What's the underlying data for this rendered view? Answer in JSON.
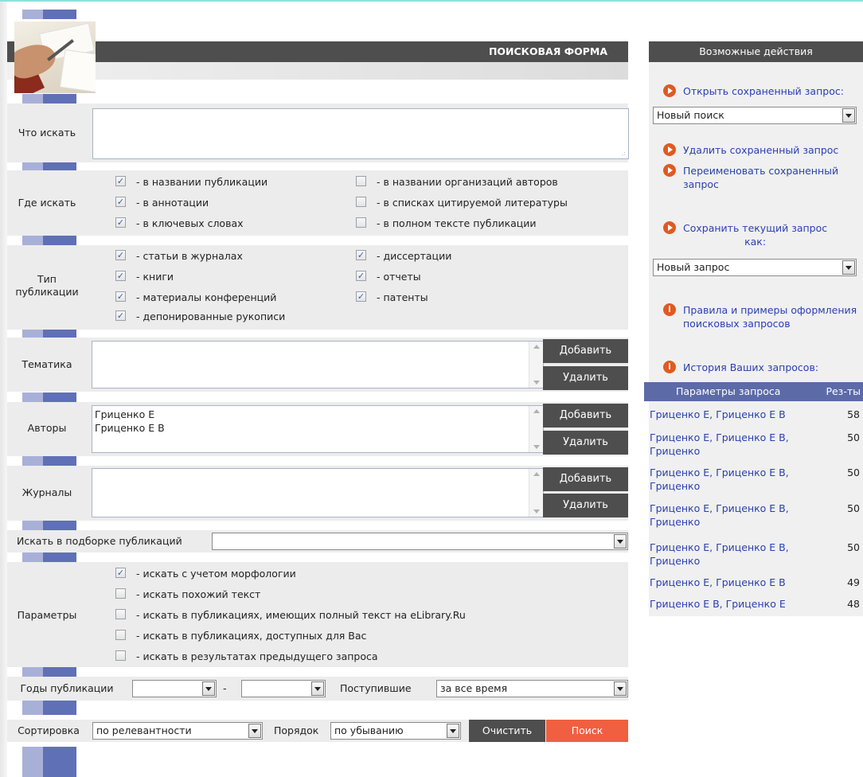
{
  "header": {
    "title": "ПОИСКОВАЯ ФОРМА"
  },
  "labels": {
    "what": "Что искать",
    "where": "Где искать",
    "type_l1": "Тип",
    "type_l2": "публикации",
    "topics": "Тематика",
    "authors": "Авторы",
    "journals": "Журналы",
    "collection": "Искать в подборке публикаций",
    "params": "Параметры",
    "years": "Годы публикации",
    "years_dash": "-",
    "received": "Поступившие",
    "sort": "Сортировка",
    "order": "Порядок"
  },
  "where": [
    {
      "label": "- в названии публикации",
      "checked": true
    },
    {
      "label": "- в аннотации",
      "checked": true
    },
    {
      "label": "- в ключевых словах",
      "checked": true
    },
    {
      "label": "- в названии организаций авторов",
      "checked": false
    },
    {
      "label": "- в списках цитируемой литературы",
      "checked": false
    },
    {
      "label": "- в полном тексте публикации",
      "checked": false
    }
  ],
  "pubtypes": [
    {
      "label": "- статьи в журналах",
      "checked": true
    },
    {
      "label": "- книги",
      "checked": true
    },
    {
      "label": "- материалы конференций",
      "checked": true
    },
    {
      "label": "- депонированные рукописи",
      "checked": true
    },
    {
      "label": "- диссертации",
      "checked": true
    },
    {
      "label": "- отчеты",
      "checked": true
    },
    {
      "label": "- патенты",
      "checked": true
    }
  ],
  "buttons": {
    "add": "Добавить",
    "remove": "Удалить",
    "clear": "Очистить",
    "search": "Поиск"
  },
  "authors": [
    "Гриценко Е",
    "Гриценко Е В"
  ],
  "params": [
    {
      "label": "- искать с учетом морфологии",
      "checked": true
    },
    {
      "label": "- искать похожий текст",
      "checked": false
    },
    {
      "label": "- искать в публикациях, имеющих полный текст на eLibrary.Ru",
      "checked": false
    },
    {
      "label": "- искать в публикациях, доступных для Вас",
      "checked": false
    },
    {
      "label": "- искать в результатах предыдущего запроса",
      "checked": false
    }
  ],
  "selects": {
    "collection": "",
    "year_from": "",
    "year_to": "",
    "received": "за все время",
    "sort": "по релевантности",
    "order": "по убыванию"
  },
  "right": {
    "title": "Возможные действия",
    "open_saved": "Открыть сохраненный запрос:",
    "saved_select": "Новый поиск",
    "delete_saved": "Удалить сохраненный запрос",
    "rename_l1": "Переименовать сохраненный",
    "rename_l2": "запрос",
    "save_l1": "Сохранить текущий запрос",
    "save_l2": "как:",
    "save_select": "Новый запрос",
    "rules_l1": "Правила и примеры оформления",
    "rules_l2": "поисковых запросов",
    "history": "История Ваших запросов:",
    "history_cols": [
      "Параметры запроса",
      "Рез-ты"
    ],
    "history_rows": [
      {
        "l1": "Гриценко Е, Гриценко Е В",
        "l2": "",
        "n": "58"
      },
      {
        "l1": "Гриценко Е, Гриценко Е В,",
        "l2": "Гриценко",
        "n": "50"
      },
      {
        "l1": "Гриценко Е, Гриценко Е В,",
        "l2": "Гриценко",
        "n": "50"
      },
      {
        "l1": "Гриценко Е, Гриценко Е В,",
        "l2": "Гриценко",
        "n": "50"
      },
      {
        "l1": "Гриценко Е, Гриценко Е В,",
        "l2": "Гриценко",
        "n": "50"
      },
      {
        "l1": "Гриценко Е, Гриценко Е В",
        "l2": "",
        "n": "49"
      },
      {
        "l1": "Гриценко Е В, Гриценко Е",
        "l2": "",
        "n": "48"
      }
    ]
  }
}
